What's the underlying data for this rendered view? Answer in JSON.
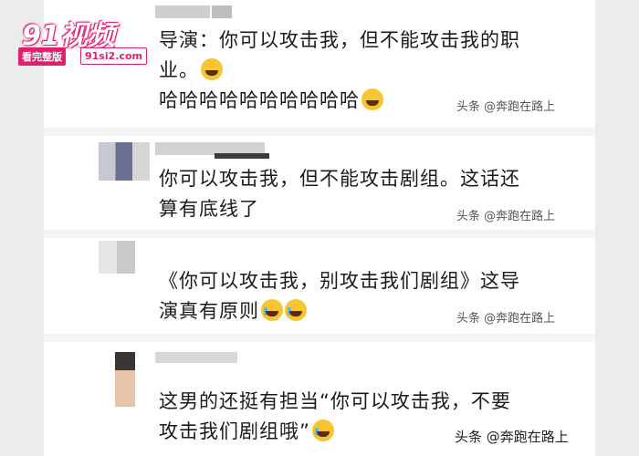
{
  "watermark": {
    "logo_text": "91视频",
    "badge_text": "看完整版",
    "url_text": "91si2.com"
  },
  "comments": [
    {
      "lines": [
        "导演：你可以攻击我，但不能攻击我的职",
        "业。"
      ],
      "extra_line": "哈哈哈哈哈哈哈哈哈哈",
      "attribution": "头条 @奔跑在路上"
    },
    {
      "lines": [
        "你可以攻击我，但不能攻击剧组。这话还",
        "算有底线了"
      ],
      "attribution": "头条 @奔跑在路上"
    },
    {
      "lines": [
        "《你可以攻击我，别攻击我们剧组》这导",
        "演真有原则"
      ],
      "attribution": "头条 @奔跑在路上"
    },
    {
      "lines": [
        "这男的还挺有担当“你可以攻击我，不要",
        "攻击我们剧组哦”"
      ],
      "attribution": "头条 @奔跑在路上"
    }
  ],
  "colors": {
    "background": "#ececec",
    "card": "#ffffff",
    "text": "#1a1a1a",
    "attribution": "#555555",
    "watermark_pink": "#e0206e"
  },
  "icons": [
    "laughing-emoji",
    "smirk-emoji",
    "crying-emoji"
  ]
}
